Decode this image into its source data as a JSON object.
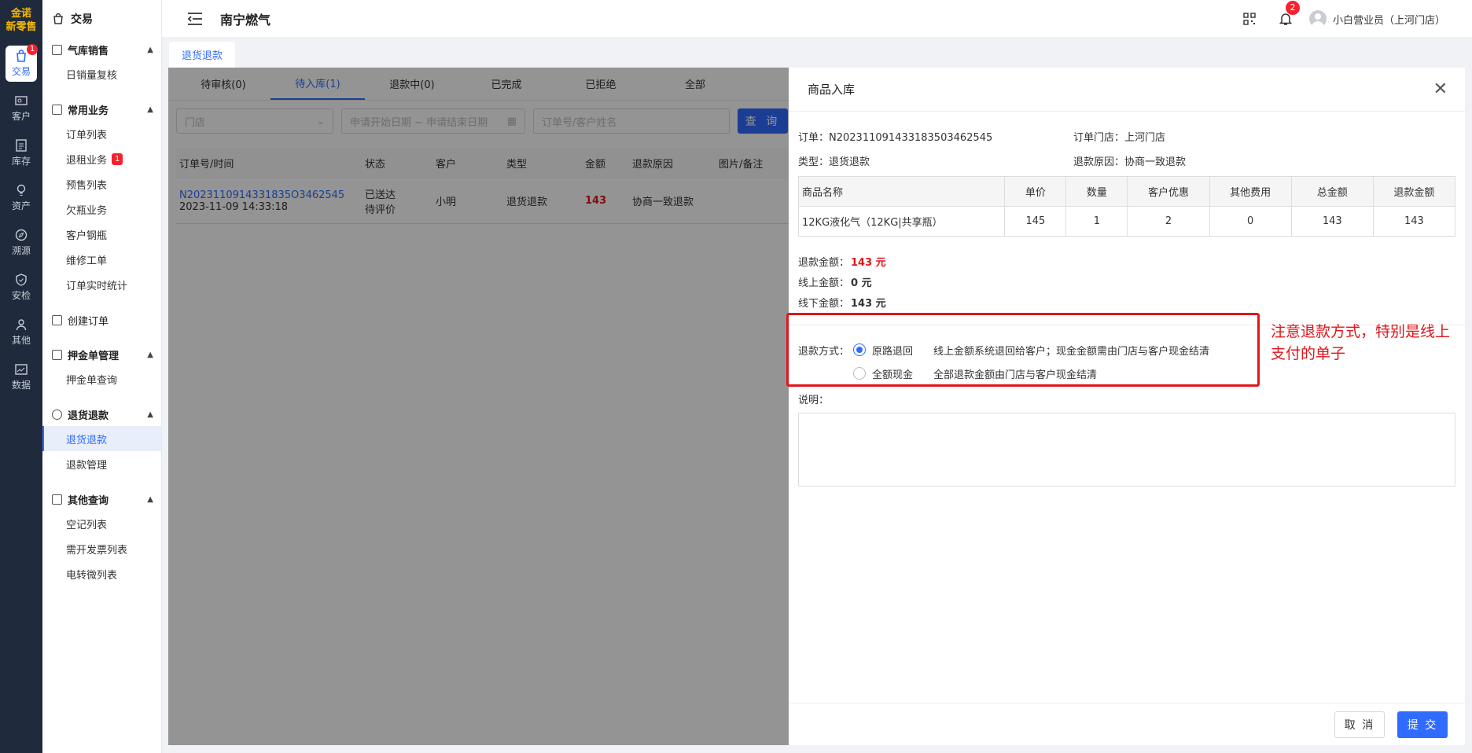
{
  "rail": {
    "logo_line1": "金诺",
    "logo_line2": "新零售",
    "items": [
      {
        "label": "交易",
        "badge": "1"
      },
      {
        "label": "客户"
      },
      {
        "label": "库存"
      },
      {
        "label": "资产"
      },
      {
        "label": "溯源"
      },
      {
        "label": "安检"
      },
      {
        "label": "其他"
      },
      {
        "label": "数据"
      }
    ]
  },
  "menu": {
    "header": "交易",
    "groups": [
      {
        "title": "气库销售",
        "items": [
          "日销量复核"
        ]
      },
      {
        "title": "常用业务",
        "items": [
          "订单列表",
          "退租业务",
          "预售列表",
          "欠瓶业务",
          "客户钢瓶",
          "维修工单",
          "订单实时统计"
        ],
        "badge_item": "退租业务",
        "badge": "1"
      },
      {
        "title": "创建订单",
        "items": []
      },
      {
        "title": "押金单管理",
        "items": [
          "押金单查询"
        ]
      },
      {
        "title": "退货退款",
        "items": [
          "退货退款",
          "退款管理"
        ],
        "active": "退货退款"
      },
      {
        "title": "其他查询",
        "items": [
          "空记列表",
          "需开发票列表",
          "电转微列表"
        ]
      }
    ]
  },
  "topbar": {
    "title": "南宁燃气",
    "bell_badge": "2",
    "user": "小白营业员（上河门店）"
  },
  "page_tab": "退货退款",
  "status_tabs": [
    "待审核(0)",
    "待入库(1)",
    "退款中(0)",
    "已完成",
    "已拒绝",
    "全部"
  ],
  "active_status_tab": "待入库(1)",
  "filters": {
    "store_placeholder": "门店",
    "date_placeholder": "申请开始日期 ~ 申请结束日期",
    "keyword_placeholder": "订单号/客户姓名",
    "query_button": "查 询"
  },
  "table": {
    "headers": [
      "订单号/时间",
      "状态",
      "客户",
      "类型",
      "金额",
      "退款原因",
      "图片/备注"
    ],
    "rows": [
      {
        "order_no": "N2023110914331835O3462545",
        "time": "2023-11-09 14:33:18",
        "status_line1": "已送达",
        "status_line2": "待评价",
        "customer": "小明",
        "type": "退货退款",
        "amount": "143",
        "reason": "协商一致退款"
      }
    ]
  },
  "drawer": {
    "title": "商品入库",
    "order_label": "订单：",
    "order_no": "N202311091433183503462545",
    "store_label": "订单门店：",
    "store": "上河门店",
    "type_label": "类型：",
    "type": "退货退款",
    "reason_label": "退款原因：",
    "reason": "协商一致退款",
    "goods_headers": [
      "商品名称",
      "单价",
      "数量",
      "客户优惠",
      "其他费用",
      "总金额",
      "退款金额"
    ],
    "goods": [
      {
        "name": "12KG液化气（12KG|共享瓶）",
        "price": "145",
        "qty": "1",
        "discount": "2",
        "other": "0",
        "total": "143",
        "refund": "143"
      }
    ],
    "refund_amount_label": "退款金额：",
    "refund_amount": "143 元",
    "online_label": "线上金额：",
    "online_amount": "0 元",
    "offline_label": "线下金额：",
    "offline_amount": "143 元",
    "refund_method_label": "退款方式：",
    "method_options": [
      {
        "label": "原路退回",
        "desc": "线上金额系统退回给客户；现金金额需由门店与客户现金结清",
        "selected": true
      },
      {
        "label": "全额现金",
        "desc": "全部退款金额由门店与客户现金结清",
        "selected": false
      }
    ],
    "remark_label": "说明：",
    "cancel_button": "取 消",
    "submit_button": "提 交"
  },
  "annotation": "注意退款方式，特别是线上支付的单子",
  "colors": {
    "accent": "#2f6bff",
    "danger": "#e0161b",
    "rail_bg": "#1f2a3c"
  }
}
